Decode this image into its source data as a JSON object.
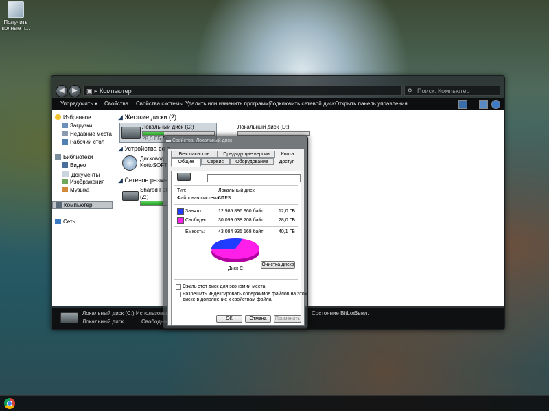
{
  "desktop": {
    "icon_label_line1": "Получить",
    "icon_label_line2": "полные п..."
  },
  "explorer": {
    "breadcrumb": [
      "Компьютер"
    ],
    "search_placeholder": "Поиск: Компьютер",
    "toolbar": [
      "Упорядочить ▾",
      "Свойства",
      "Свойства системы",
      "Удалить или изменить программу",
      "Подключить сетевой диск",
      "Открыть панель управления"
    ],
    "nav": {
      "favorites": "Избранное",
      "downloads": "Загрузки",
      "recent": "Недавние места",
      "desktop": "Рабочий стол",
      "libraries": "Библиотеки",
      "video": "Видео",
      "documents": "Документы",
      "images": "Изображения",
      "music": "Музыка",
      "computer": "Компьютер",
      "network": "Сеть"
    },
    "groups": {
      "hard_disks": "Жесткие диски (2)",
      "devices": "Устройства со с",
      "network_loc": "Сетевое размещ"
    },
    "drives": {
      "c_name": "Локальный диск (C:)",
      "c_free": "28,0 ГБ св",
      "c_fill": 0.3,
      "d_name": "Локальный диск (D:)",
      "dvd_line1": "Дисковод",
      "dvd_line2": "KottoSOFT",
      "share_line1": "Shared Fol",
      "share_line2": "(Z:)"
    },
    "status": {
      "title": "Локальный диск (C:) Использовано:",
      "subtitle": "Локальный диск",
      "free": "Свободно:",
      "bitlocker": "Состояние BitLoc...",
      "bitlocker_value": "Выкл."
    }
  },
  "dialog": {
    "title": "Свойства: Локальный диск",
    "tabs": {
      "security": "Безопасность",
      "prev_versions": "Предыдущие версии",
      "quota": "Квота",
      "general": "Общие",
      "service": "Сервис",
      "hardware": "Оборудование",
      "access": "Доступ"
    },
    "name_value": "",
    "type_label": "Тип:",
    "type_value": "Локальный диск",
    "fs_label": "Файловая система:",
    "fs_value": "NTFS",
    "used_label": "Занято:",
    "used_bytes": "12 985 896 960 байт",
    "used_gb": "12,0 ГБ",
    "free_label": "Свободно:",
    "free_bytes": "30 099 038 208 байт",
    "free_gb": "28,0 ГБ",
    "capacity_label": "Емкость:",
    "capacity_bytes": "43 084 935 168 байт",
    "capacity_gb": "40,1 ГБ",
    "disk_label": "Диск C:",
    "cleanup_button": "Очистка диска",
    "compress_label": "Сжать этот диск для экономии места",
    "index_label_line1": "Разрешить индексировать содержимое файлов на этом",
    "index_label_line2": "диске в дополнение к свойствам файла",
    "ok": "ОК",
    "cancel": "Отмена",
    "apply": "Применить",
    "colors": {
      "used": "#1f3cff",
      "free": "#ff1fe8"
    }
  }
}
